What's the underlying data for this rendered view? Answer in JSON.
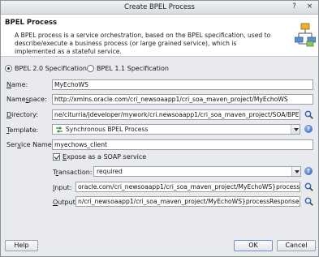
{
  "window": {
    "title": "Create BPEL Process",
    "help_glyph": "?",
    "close_glyph": "×"
  },
  "header": {
    "title": "BPEL Process",
    "description": "A BPEL process is a service orchestration, based on the BPEL specification, used to describe/execute a business process (or large grained service), which is implemented as a stateful service."
  },
  "spec": {
    "options": [
      {
        "label": "BPEL 2.0 Specification",
        "selected": true
      },
      {
        "label": "BPEL 1.1 Specification",
        "selected": false
      }
    ]
  },
  "form": {
    "name": {
      "label_u": "N",
      "label_rest": "ame:",
      "value": "MyEchoWS"
    },
    "namespace": {
      "label_pre": "Name",
      "label_u": "s",
      "label_rest": "pace:",
      "value": "http://xmlns.oracle.com/cri_newsoaapp1/cri_soa_maven_project/MyEchoWS"
    },
    "directory": {
      "label_u": "D",
      "label_rest": "irectory:",
      "value": "ne/citurria/jdeveloper/mywork/cri.newsoaapp1/cri_soa_maven_project/SOA/BPEL"
    },
    "template": {
      "label_u": "T",
      "label_rest": "emplate:",
      "value": "Synchronous BPEL Process"
    },
    "service_name": {
      "label_pre": "Ser",
      "label_u": "v",
      "label_rest": "ice Name:",
      "value": "myechows_client"
    },
    "expose": {
      "label_u": "E",
      "label_rest": "xpose as a SOAP service",
      "checked": true
    },
    "transaction": {
      "label_pre": "T",
      "label_u": "r",
      "label_rest": "ansaction:",
      "value": "required"
    },
    "input": {
      "label_u": "I",
      "label_rest": "nput:",
      "value": "oracle.com/cri_newsoaapp1/cri_soa_maven_project/MyEchoWS}process"
    },
    "output": {
      "label_u": "O",
      "label_rest": "utput:",
      "value": "n/cri_newsoaapp1/cri_soa_maven_project/MyEchoWS}processResponse"
    }
  },
  "buttons": {
    "help": "Help",
    "ok": "OK",
    "cancel": "Cancel"
  },
  "colors": {
    "accent": "#2f62b9",
    "header_bg": "#ffffff",
    "dialog_bg": "#e8eaed"
  }
}
